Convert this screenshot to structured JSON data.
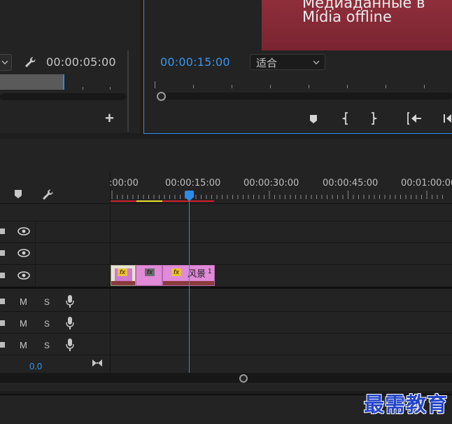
{
  "source_panel": {
    "timecode": "00:00:05:00",
    "add_label": "+"
  },
  "program_monitor": {
    "offline_line1": "Медиаданные в",
    "offline_line2": "Mídia offline",
    "timecode": "00:00:15:00",
    "zoom_select": "适合",
    "colors": {
      "accent": "#2d8ceb",
      "offline_bg": "#8e2c3a"
    }
  },
  "timeline": {
    "ruler_labels": [
      ":00:00",
      "00:00:15:00",
      "00:00:30:00",
      "00:00:45:00",
      "00:01:00:00"
    ],
    "video_tracks": 3,
    "audio_tracks": [
      {
        "m": "M",
        "s": "S"
      },
      {
        "m": "M",
        "s": "S"
      },
      {
        "m": "M",
        "s": "S"
      }
    ],
    "master_volume": "0.0",
    "clips": [
      {
        "fx": "fx",
        "name": "",
        "color": "#e7e2d2"
      },
      {
        "fx": "fx",
        "name": "",
        "color": "#e08ad8"
      },
      {
        "fx": "fx",
        "name": "风景",
        "suffix": "1",
        "color": "#e08ad8"
      }
    ],
    "colors": {
      "playhead": "#2d8ceb",
      "work_area": "#d01f2a",
      "render_yellow": "#e6df2b"
    }
  },
  "watermark": {
    "text": "最需教育"
  }
}
